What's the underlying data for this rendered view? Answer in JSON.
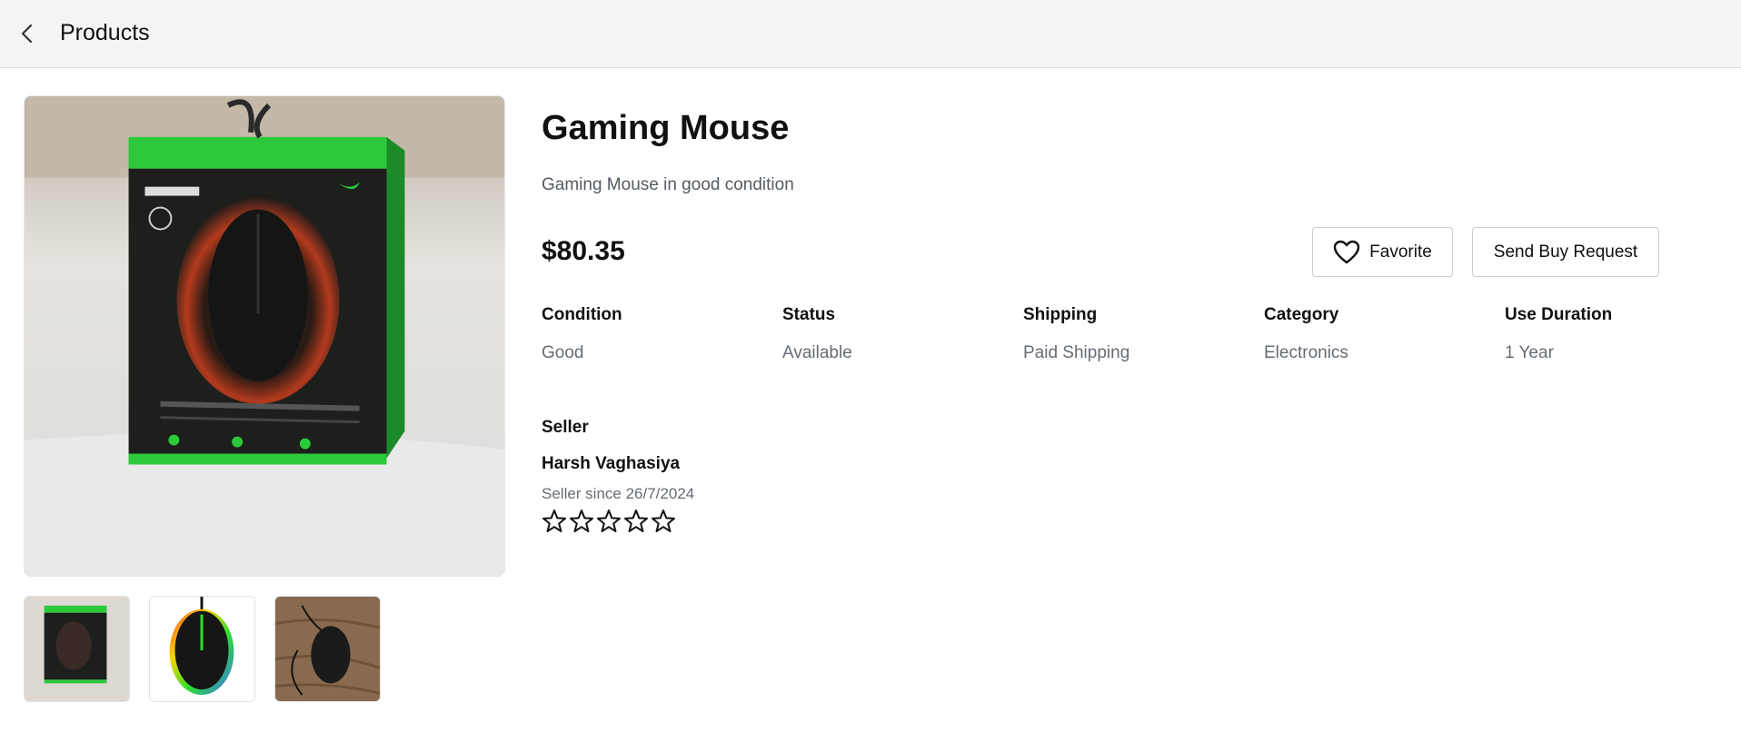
{
  "header": {
    "back_icon": "chevron-left-icon",
    "title": "Products"
  },
  "product": {
    "name": "Gaming Mouse",
    "description": "Gaming Mouse in good condition",
    "price": "$80.35",
    "images": [
      "main-product-photo",
      "thumbnail-boxed",
      "thumbnail-rgb-mouse",
      "thumbnail-mouse-on-wood"
    ],
    "actions": {
      "favorite_label": "Favorite",
      "favorite_icon": "heart-icon",
      "buy_request_label": "Send Buy Request"
    },
    "attributes": [
      {
        "label": "Condition",
        "value": "Good"
      },
      {
        "label": "Status",
        "value": "Available"
      },
      {
        "label": "Shipping",
        "value": "Paid Shipping"
      },
      {
        "label": "Category",
        "value": "Electronics"
      },
      {
        "label": "Use Duration",
        "value": "1 Year"
      }
    ]
  },
  "seller": {
    "heading": "Seller",
    "name": "Harsh Vaghasiya",
    "since": "Seller since 26/7/2024",
    "rating": 0,
    "rating_max": 5
  }
}
